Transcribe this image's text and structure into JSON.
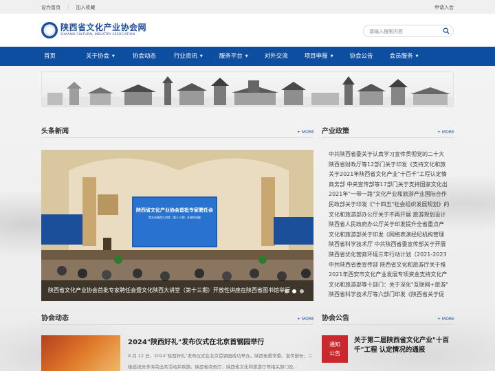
{
  "topbar": {
    "set_home": "设为首页",
    "add_favorite": "加入收藏",
    "join": "申请入会"
  },
  "header": {
    "logo_cn": "陕西省文化产业协会网",
    "logo_en": "SHAANXI CULTURAL INDUSTRY ASSOCIATION",
    "search_placeholder": "请输入搜索内容"
  },
  "nav": {
    "items": [
      {
        "label": "首页",
        "caret": false
      },
      {
        "label": "关于协会",
        "caret": true
      },
      {
        "label": "协会动态",
        "caret": false
      },
      {
        "label": "行业资讯",
        "caret": true
      },
      {
        "label": "服务平台",
        "caret": true
      },
      {
        "label": "对外交流",
        "caret": false
      },
      {
        "label": "项目申报",
        "caret": true
      },
      {
        "label": "协会公告",
        "caret": false
      },
      {
        "label": "会员服务",
        "caret": true
      }
    ]
  },
  "headline": {
    "title": "头条新闻",
    "more": "+ MORE",
    "caption": "陕西省文化产业协会首批专家聘任会暨文化陕西大讲堂（第十三期）开放性讲座在陕西省图书馆举行",
    "screen_title": "陕西省文化产业协会首批专家聘任会",
    "screen_sub": "暨文化陕西大讲堂（第十三期）开放性讲座"
  },
  "policy": {
    "title": "产业政策",
    "more": "+ MORE",
    "items": [
      "中共陕西省委关于认真学习宣传贯彻党的二十大",
      "陕西省财政厅等12部门关于印发《支持文化和旅",
      "关于2021年陕西省文化产业\"十百千\"工程认定情",
      "商务部 中央宣传部等17部门关于支持国家文化出",
      "2021年\"一带一路\"文化产业和旅游产业国际合作",
      "民政部关于印发《\"十四五\"社会组织发展规划》的",
      "文化和旅游部办公厅关于不再开展 旅游规划设计",
      "陕西省人民政府办公厅关于印发提升全省重点产",
      "文化和旅游部关于印发《网络表演经纪机构管理",
      "陕西省科学技术厅 中共陕西省委宣传部关于开展",
      "陕西省优化营商环境三年行动计划（2021-2023",
      "中共陕西省委宣传部 陕西省文化和旅游厅关于推",
      "2021年西安市文化产业发展专项资金支持文化产",
      "文化和旅游部等十部门：关于深化\"互联网+旅游\"",
      "陕西省科学技术厅等六部门印发《陕西省关于促"
    ]
  },
  "dynamics": {
    "title": "协会动态",
    "more": "+ MORE",
    "news_title": "2024\"陕西好礼\"发布仪式在北京首钢园举行",
    "summary": "9 月 12 日，2024\"陕西好礼\"发布仪式在北京首钢园成功举办。陕西省委常委、宣传部长、二级巡视员李海荣出席活动并致辞。陕西省商务厅、陕西省文化和旅游厅等相关部门及..."
  },
  "notice": {
    "title": "协会公告",
    "more": "+ MORE",
    "badge_line1": "通知",
    "badge_line2": "公告",
    "item_title": "关于第二届陕西省文化产业\"十百千\"工程 认定情况的通报"
  },
  "colors": {
    "nav_blue": "#0d4ea1",
    "brand_blue": "#1f4e9c",
    "notice_red": "#c9282d"
  }
}
